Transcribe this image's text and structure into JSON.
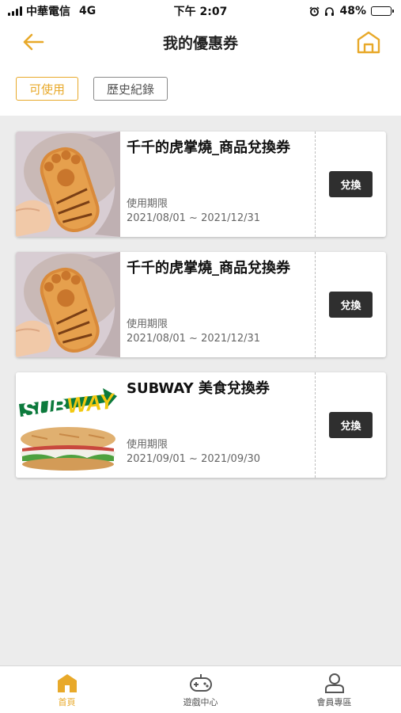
{
  "status_bar": {
    "carrier": "中華電信",
    "network": "4G",
    "time": "下午 2:07",
    "battery": "48%",
    "battery_level": 0.48
  },
  "header": {
    "title": "我的優惠券",
    "back_icon": "arrow-left-icon",
    "home_icon": "home-icon"
  },
  "filters": {
    "available": "可使用",
    "history": "歷史紀錄"
  },
  "coupons": [
    {
      "title": "千千的虎掌燒_商品兌換券",
      "validity_label": "使用期限",
      "validity_date": "2021/08/01 ~ 2021/12/31",
      "action": "兌換",
      "image": "tiger-paw-cake-image"
    },
    {
      "title": "千千的虎掌燒_商品兌換券",
      "validity_label": "使用期限",
      "validity_date": "2021/08/01 ~ 2021/12/31",
      "action": "兌換",
      "image": "tiger-paw-cake-image"
    },
    {
      "title": "SUBWAY 美食兌換券",
      "validity_label": "使用期限",
      "validity_date": "2021/09/01 ~ 2021/09/30",
      "action": "兌換",
      "image": "subway-sandwich-image",
      "logo_text": "SUBWAY"
    }
  ],
  "bottom_nav": {
    "home": "首頁",
    "games": "遊戲中心",
    "member": "會員專區"
  },
  "colors": {
    "accent": "#e8a92a",
    "button_dark": "#2f2f2f",
    "background": "#ececec"
  }
}
